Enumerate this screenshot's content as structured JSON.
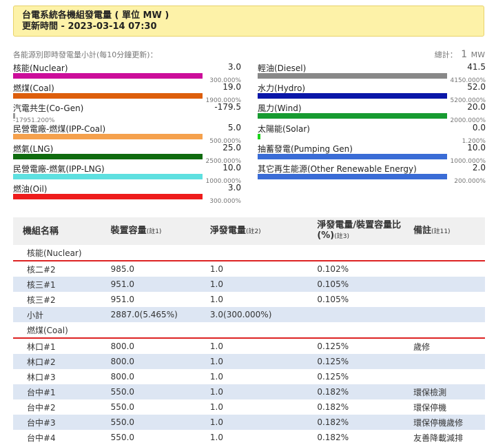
{
  "header": {
    "title": "台電系統各機組發電量 ( 單位 MW )",
    "updated": "更新時間 - 2023-03-14 07:30"
  },
  "summary": {
    "hint": "各能源別即時發電量小計(每10分鐘更新)：",
    "total_label": "總計：",
    "total_value": "1",
    "total_unit": "MW"
  },
  "sources_left": [
    {
      "name": "核能(Nuclear)",
      "value": "3.0",
      "pct": "300.000%",
      "color": "#cc0e9a",
      "fill": 0.83
    },
    {
      "name": "燃煤(Coal)",
      "value": "19.0",
      "pct": "1900.000%",
      "color": "#dd5e0c",
      "fill": 0.83
    },
    {
      "name": "汽電共生(Co-Gen)",
      "value": "-179.5",
      "pct": "-17951.200%",
      "color": "#999999",
      "fill": 0.0
    },
    {
      "name": "民營電廠-燃煤(IPP-Coal)",
      "value": "5.0",
      "pct": "500.000%",
      "color": "#f5a14d",
      "fill": 0.83
    },
    {
      "name": "燃氣(LNG)",
      "value": "25.0",
      "pct": "2500.000%",
      "color": "#0f6b0f",
      "fill": 0.83
    },
    {
      "name": "民營電廠-燃氣(IPP-LNG)",
      "value": "10.0",
      "pct": "1000.000%",
      "color": "#5ee0e0",
      "fill": 0.83
    },
    {
      "name": "燃油(Oil)",
      "value": "3.0",
      "pct": "300.000%",
      "color": "#ee1c1c",
      "fill": 0.83
    }
  ],
  "sources_right": [
    {
      "name": "輕油(Diesel)",
      "value": "41.5",
      "pct": "4150.000%",
      "color": "#888888",
      "fill": 0.83
    },
    {
      "name": "水力(Hydro)",
      "value": "52.0",
      "pct": "5200.000%",
      "color": "#0a17a8",
      "fill": 0.83
    },
    {
      "name": "風力(Wind)",
      "value": "20.0",
      "pct": "2000.000%",
      "color": "#179b31",
      "fill": 0.83
    },
    {
      "name": "太陽能(Solar)",
      "value": "0.0",
      "pct": "1.200%",
      "color": "#1bd41b",
      "fill": 0.012
    },
    {
      "name": "抽蓄發電(Pumping Gen)",
      "value": "10.0",
      "pct": "1000.000%",
      "color": "#3a6cd6",
      "fill": 0.83
    },
    {
      "name": "其它再生能源(Other Renewable Energy)",
      "value": "2.0",
      "pct": "200.000%",
      "color": "#3a6cd6",
      "fill": 0.83
    }
  ],
  "table": {
    "headers": [
      {
        "text": "機組名稱",
        "note": ""
      },
      {
        "text": "裝置容量",
        "note": "(註1)"
      },
      {
        "text": "淨發電量",
        "note": "(註2)"
      },
      {
        "text": "淨發電量/裝置容量比(%)",
        "note": "(註3)"
      },
      {
        "text": "備註",
        "note": "(註11)"
      }
    ],
    "groups": [
      {
        "name": "核能(Nuclear)",
        "rows": [
          [
            "核二#2",
            "985.0",
            "1.0",
            "0.102%",
            ""
          ],
          [
            "核三#1",
            "951.0",
            "1.0",
            "0.105%",
            ""
          ],
          [
            "核三#2",
            "951.0",
            "1.0",
            "0.105%",
            ""
          ],
          [
            "小計",
            "2887.0(5.465%)",
            "3.0(300.000%)",
            "",
            ""
          ]
        ]
      },
      {
        "name": "燃煤(Coal)",
        "rows": [
          [
            "林口#1",
            "800.0",
            "1.0",
            "0.125%",
            "歲修"
          ],
          [
            "林口#2",
            "800.0",
            "1.0",
            "0.125%",
            ""
          ],
          [
            "林口#3",
            "800.0",
            "1.0",
            "0.125%",
            ""
          ],
          [
            "台中#1",
            "550.0",
            "1.0",
            "0.182%",
            "環保檢測"
          ],
          [
            "台中#2",
            "550.0",
            "1.0",
            "0.182%",
            "環保停機"
          ],
          [
            "台中#3",
            "550.0",
            "1.0",
            "0.182%",
            "環保停機歲修"
          ],
          [
            "台中#4",
            "550.0",
            "1.0",
            "0.182%",
            "友善降載減排"
          ]
        ]
      }
    ]
  }
}
